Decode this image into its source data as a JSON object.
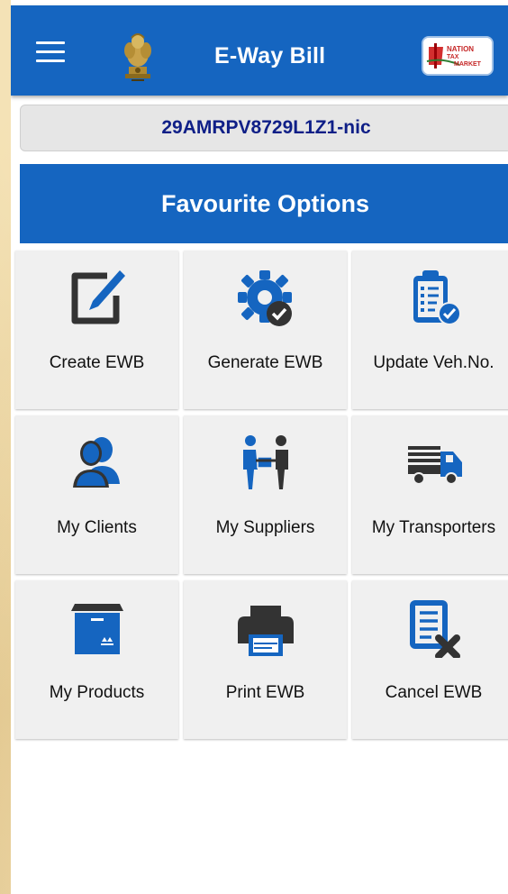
{
  "appbar": {
    "title": "E-Way Bill",
    "menu_icon": "hamburger-menu-icon",
    "emblem_icon": "national-emblem-icon",
    "logo": {
      "name": "nation-tax-market-logo",
      "line1": "NATION",
      "line2": "TAX",
      "line3": "MARKET"
    }
  },
  "gstin": "29AMRPV8729L1Z1-nic",
  "favourites": {
    "title": "Favourite Options",
    "items": [
      {
        "label": "Create EWB",
        "icon": "edit-square-icon"
      },
      {
        "label": "Generate EWB",
        "icon": "gear-check-icon"
      },
      {
        "label": "Update Veh.No.",
        "icon": "clipboard-check-icon"
      },
      {
        "label": "My Clients",
        "icon": "users-icon"
      },
      {
        "label": "My Suppliers",
        "icon": "handover-icon"
      },
      {
        "label": "My Transporters",
        "icon": "truck-icon"
      },
      {
        "label": "My Products",
        "icon": "package-box-icon"
      },
      {
        "label": "Print EWB",
        "icon": "printer-icon"
      },
      {
        "label": "Cancel EWB",
        "icon": "document-cancel-icon"
      }
    ]
  },
  "colors": {
    "primary": "#1565c0",
    "gstin_text": "#0f1f87",
    "icon_dark": "#333333",
    "tile_bg": "#f0f0f0"
  }
}
